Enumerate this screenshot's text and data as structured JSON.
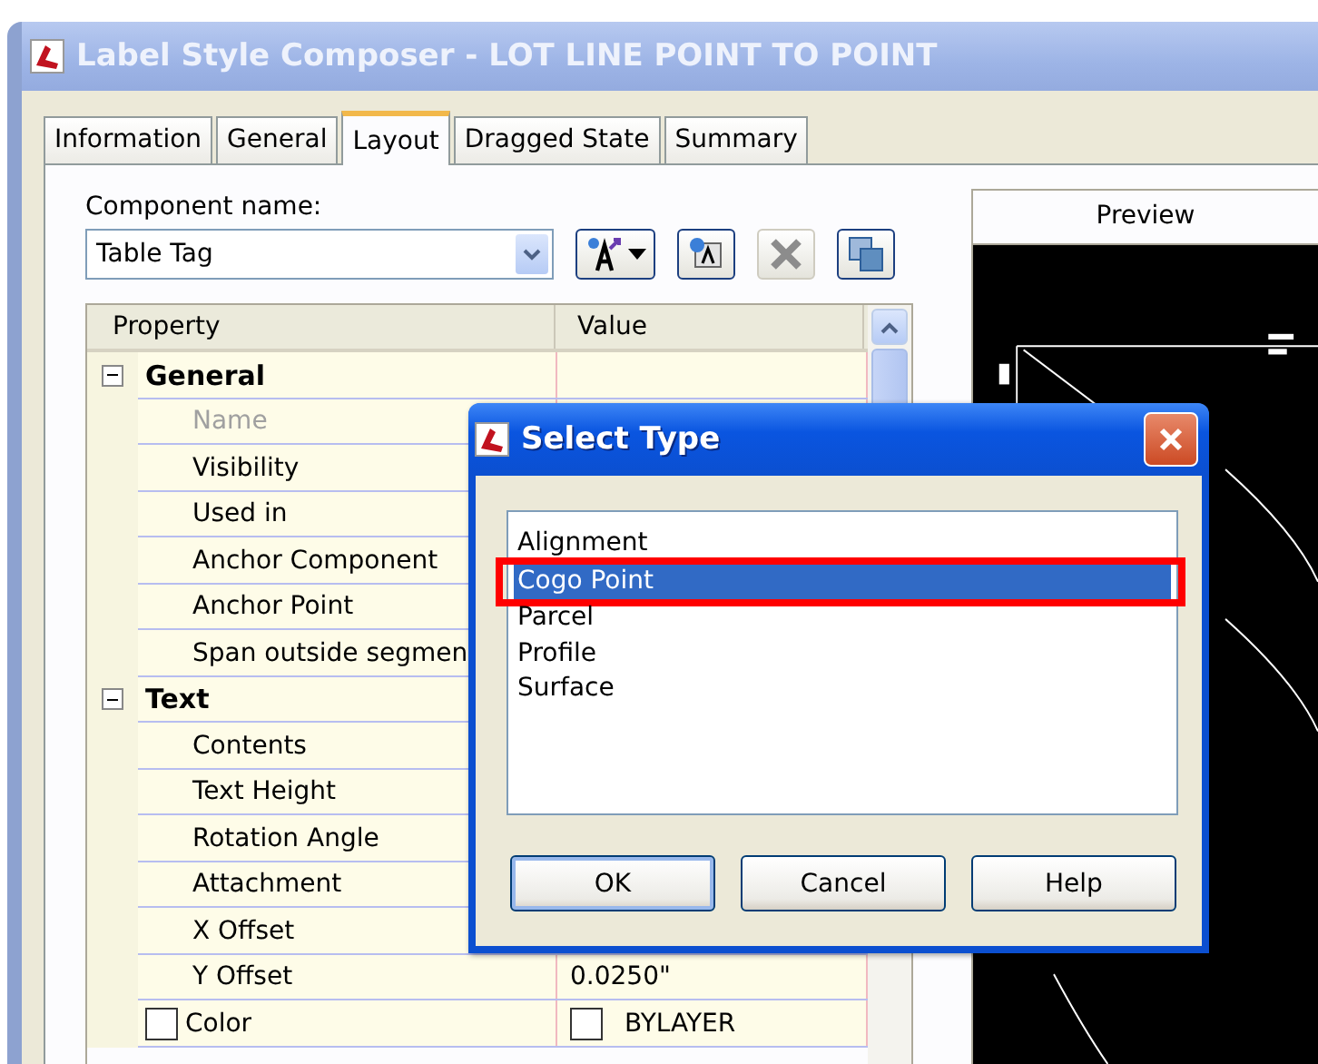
{
  "window": {
    "title": "Label Style Composer - LOT LINE POINT TO POINT"
  },
  "tabs": [
    {
      "label": "Information",
      "selected": false
    },
    {
      "label": "General",
      "selected": false
    },
    {
      "label": "Layout",
      "selected": true
    },
    {
      "label": "Dragged State",
      "selected": false
    },
    {
      "label": "Summary",
      "selected": false
    }
  ],
  "component_name": {
    "label": "Component name:",
    "value": "Table Tag"
  },
  "property_grid": {
    "columns": [
      "Property",
      "Value"
    ],
    "categories": [
      {
        "name": "General",
        "expanded": true,
        "rows": [
          {
            "kind": "plain",
            "name": "Name",
            "disabled": true
          },
          {
            "kind": "plain",
            "name": "Visibility",
            "disabled": false
          },
          {
            "kind": "plain",
            "name": "Used in",
            "disabled": false
          },
          {
            "kind": "plain",
            "name": "Anchor Component",
            "disabled": false
          },
          {
            "kind": "plain",
            "name": "Anchor Point",
            "disabled": false
          },
          {
            "kind": "plain",
            "name": "Span outside segmen",
            "disabled": false
          }
        ]
      },
      {
        "name": "Text",
        "expanded": true,
        "rows": [
          {
            "kind": "plain",
            "name": "Contents",
            "disabled": false
          },
          {
            "kind": "plain",
            "name": "Text Height",
            "disabled": false
          },
          {
            "kind": "plain",
            "name": "Rotation Angle",
            "disabled": false
          },
          {
            "kind": "plain",
            "name": "Attachment",
            "disabled": false
          },
          {
            "kind": "plain",
            "name": "X Offset",
            "disabled": false
          },
          {
            "kind": "plain",
            "name": "Y Offset",
            "disabled": false,
            "value": "0.0250\""
          },
          {
            "kind": "color",
            "name": "Color",
            "disabled": false,
            "value": "BYLAYER"
          }
        ]
      }
    ]
  },
  "preview": {
    "title": "Preview"
  },
  "dialog": {
    "title": "Select Type",
    "items": [
      {
        "label": "Alignment",
        "selected": false,
        "highlighted": false
      },
      {
        "label": "Cogo Point",
        "selected": true,
        "highlighted": true
      },
      {
        "label": "Parcel",
        "selected": false,
        "highlighted": false
      },
      {
        "label": "Profile",
        "selected": false,
        "highlighted": false
      },
      {
        "label": "Surface",
        "selected": false,
        "highlighted": false
      }
    ],
    "buttons": [
      {
        "label": "OK",
        "default": true
      },
      {
        "label": "Cancel",
        "default": false
      },
      {
        "label": "Help",
        "default": false
      }
    ]
  }
}
